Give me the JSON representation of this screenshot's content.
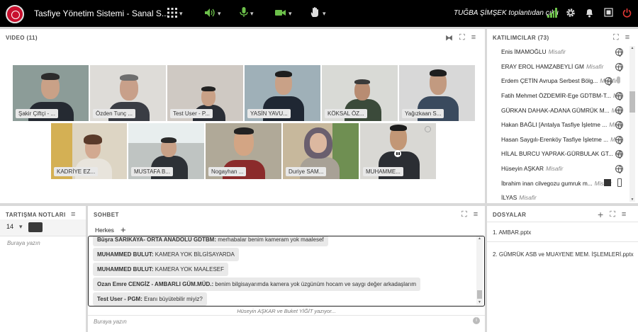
{
  "app": {
    "title": "Tasfiye Yönetim Sistemi - Sanal S...",
    "status": "TUĞBA ŞİMŞEK toplantıdan çıktı"
  },
  "toolbar": {
    "icons": [
      "grid-icon",
      "speaker-icon",
      "microphone-icon",
      "camera-icon",
      "raise-hand-icon",
      "signal-icon",
      "gear-icon",
      "bell-icon",
      "fullscreen-icon",
      "power-icon"
    ]
  },
  "video": {
    "header": "VIDEO (11)",
    "tiles": [
      {
        "label": "Şakir Çiftçi - ..."
      },
      {
        "label": "Özden Tunç ..."
      },
      {
        "label": "Test User - P..."
      },
      {
        "label": "YASİN YAVU..."
      },
      {
        "label": "KÖKSAL ÖZ..."
      },
      {
        "label": "Yağızkaan S..."
      },
      {
        "label": "KADRİYE EZ..."
      },
      {
        "label": "MUSTAFA B..."
      },
      {
        "label": "Nogayhan ..."
      },
      {
        "label": "Duriye SAM..."
      },
      {
        "label": "MUHAMME..."
      }
    ]
  },
  "participants": {
    "header": "KATILIMCILAR  (73)",
    "items": [
      {
        "name": "Enis İMAMOĞLU",
        "role": "Misafir"
      },
      {
        "name": "ERAY EROL HAMZABEYLİ GM",
        "role": "Misafir"
      },
      {
        "name": "Erdem ÇETİN Avrupa Serbest Bölg...",
        "role": "Misafir"
      },
      {
        "name": "Fatih Mehmet ÖZDEMİR-Ege GDTBM-T...",
        "role": "Misafir"
      },
      {
        "name": "GÜRKAN DAHAK-ADANA GÜMRÜK M...",
        "role": "Misafir"
      },
      {
        "name": "Hakan BAĞLI [Antalya Tasfiye İşletme ...",
        "role": "Misafir"
      },
      {
        "name": "Hasan Saygılı-Erenköy Tasfiye İşletme ...",
        "role": "Misafir"
      },
      {
        "name": "HİLAL BURCU YAPRAK-GÜRBULAK GT...",
        "role": "Misafir"
      },
      {
        "name": "Hüseyin AŞKAR",
        "role": "Misafir"
      },
      {
        "name": "İbrahim inan cilvegozu gumruk m...",
        "role": "Misafir"
      },
      {
        "name": "İLYAS",
        "role": "Misafir"
      }
    ]
  },
  "notes": {
    "header": "TARTIŞMA NOTLARI",
    "font_size": "14",
    "placeholder": "Buraya yazın"
  },
  "chat": {
    "header": "SOHBET",
    "recipient": "Herkes",
    "messages": [
      {
        "sender": "Büşra SARIKAYA- ORTA ANADOLU GDTBM:",
        "text": "merhabalar benim kameram yok maalesef"
      },
      {
        "sender": "MUHAMMED BULUT:",
        "text": "KAMERA YOK BİLGİSAYARDA"
      },
      {
        "sender": "MUHAMMED BULUT:",
        "text": "KAMERA YOK MAALESEF"
      },
      {
        "sender": "Ozan Emre CENGİZ - AMBARLI GÜM.MÜD.:",
        "text": "benim bilgisayarımda kamera yok üzgünüm hocam ve saygı değer arkadaşlarım"
      },
      {
        "sender": "Test User - PGM:",
        "text": "Eranı büyütebilir miyiz?"
      }
    ],
    "typing": "Hüseyin AŞKAR ve Buket YİĞİT yazıyor...",
    "placeholder": "Buraya yazın"
  },
  "files": {
    "header": "DOSYALAR",
    "items": [
      {
        "label": "1. AMBAR.pptx"
      },
      {
        "label": "2. GÜMRÜK ASB ve MUAYENE MEM. İŞLEMLERİ.pptx"
      }
    ]
  },
  "colors": {
    "topbar": "#000000",
    "accent_green": "#6cc04a",
    "power_red": "#e53935",
    "separator": "#d9d9d9"
  }
}
